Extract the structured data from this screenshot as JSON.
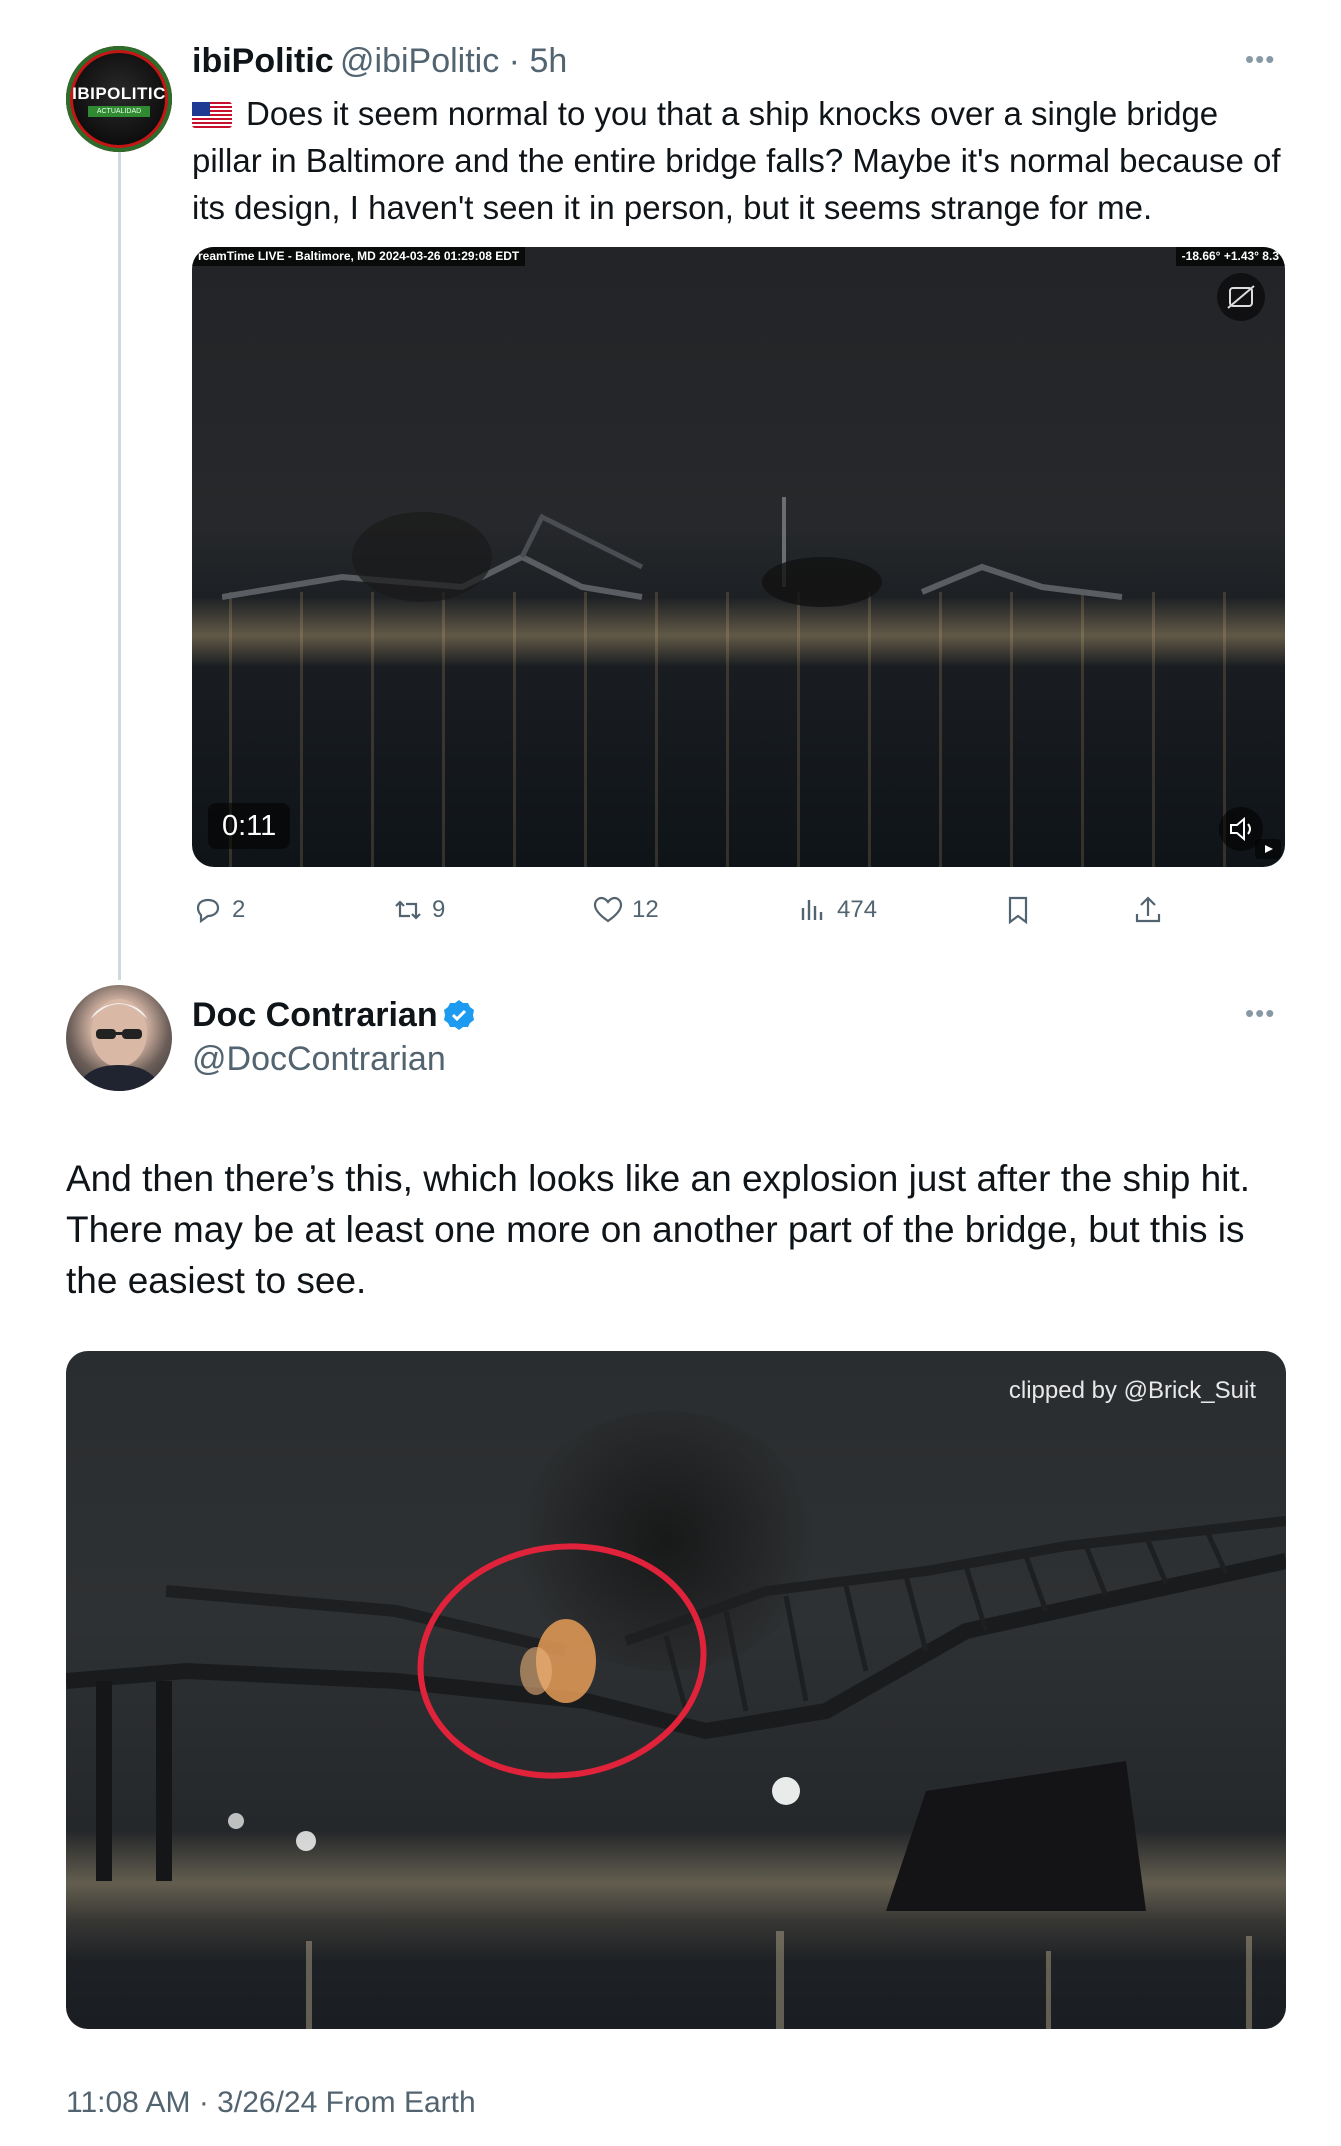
{
  "tweet1": {
    "avatar_logo": "IBIPOLITIC",
    "avatar_sub": "ACTUALIDAD",
    "name": "ibiPolitic",
    "handle_time": "@ibiPolitic · 5h",
    "text": "Does it seem normal to you that a ship knocks over a single bridge pillar in Baltimore and the entire bridge falls? Maybe it's normal because of its design, I haven't seen it in person, but it seems strange for me.",
    "video": {
      "overlay_left": "reamTime LIVE - Baltimore, MD 2024-03-26  01:29:08 EDT",
      "overlay_right": "-18.66°  +1.43°  8.3",
      "duration": "0:11"
    },
    "actions": {
      "replies": "2",
      "reposts": "9",
      "likes": "12",
      "views": "474"
    }
  },
  "tweet2": {
    "name": "Doc Contrarian",
    "handle": "@DocContrarian",
    "text": "And then there’s this, which looks like an explosion just after the ship hit. There may be at least one more on another part of the bridge, but this is the easiest to see.",
    "image_caption": "clipped by @Brick_Suit",
    "meta": "11:08 AM · 3/26/24 From Earth"
  },
  "colors": {
    "text_primary": "#0f1419",
    "text_secondary": "#536471",
    "verified_blue": "#1d9bf0",
    "highlight_circle": "#e0233a"
  }
}
